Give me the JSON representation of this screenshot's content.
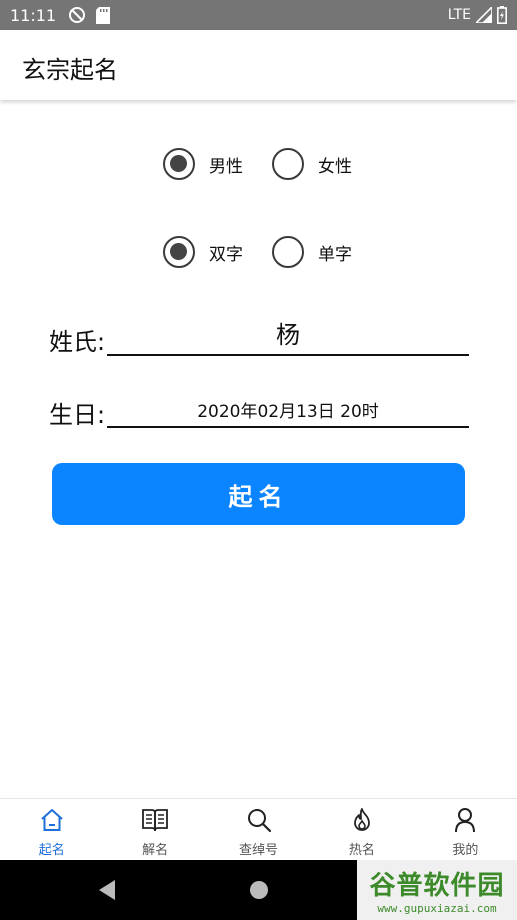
{
  "status_bar": {
    "time": "11:11",
    "network": "LTE"
  },
  "app_bar": {
    "title": "玄宗起名"
  },
  "gender": {
    "options": [
      "男性",
      "女性"
    ],
    "selected": 0
  },
  "name_length": {
    "options": [
      "双字",
      "单字"
    ],
    "selected": 0
  },
  "surname": {
    "label": "姓氏:",
    "value": "杨"
  },
  "birthday": {
    "label": "生日:",
    "value": "2020年02月13日 20时"
  },
  "submit": {
    "label": "起名"
  },
  "bottom_nav": {
    "items": [
      {
        "label": "起名",
        "icon": "home-icon",
        "active": true
      },
      {
        "label": "解名",
        "icon": "book-icon",
        "active": false
      },
      {
        "label": "查绰号",
        "icon": "search-icon",
        "active": false
      },
      {
        "label": "热名",
        "icon": "flame-icon",
        "active": false
      },
      {
        "label": "我的",
        "icon": "person-icon",
        "active": false
      }
    ]
  },
  "watermark": {
    "main": "谷普软件园",
    "sub": "www.gupuxiazai.com"
  },
  "colors": {
    "accent": "#0a84ff",
    "nav_active": "#1e6fd9",
    "status_bar": "#757575"
  }
}
